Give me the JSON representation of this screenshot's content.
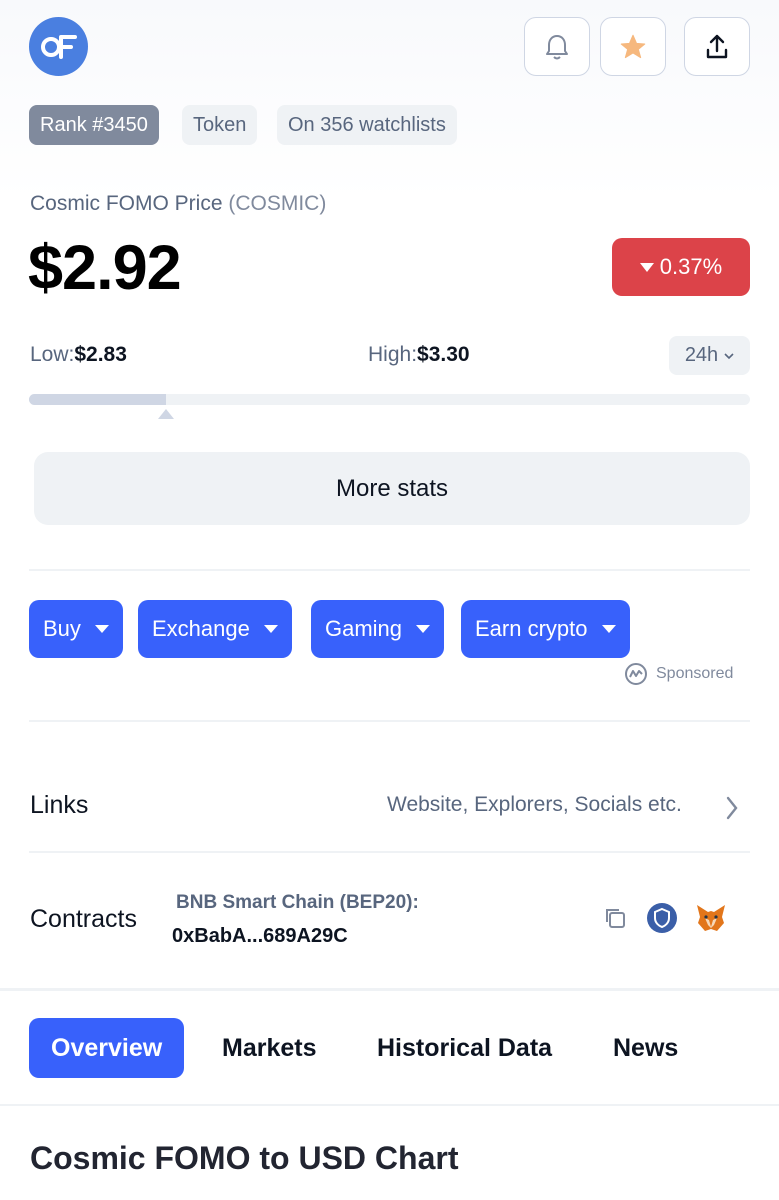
{
  "header": {
    "logo_icon": "cosmic-fomo-logo",
    "buttons": [
      {
        "icon": "bell-icon"
      },
      {
        "icon": "star-icon",
        "color": "#f6b87e"
      },
      {
        "icon": "share-icon"
      }
    ]
  },
  "badges": {
    "rank": "Rank #3450",
    "type": "Token",
    "watchlists": "On 356 watchlists"
  },
  "coin": {
    "name_label": "Cosmic FOMO Price",
    "symbol": "(COSMIC)",
    "price": "$2.92",
    "change": "0.37%",
    "change_direction": "down",
    "change_color": "#dc4349"
  },
  "range": {
    "low_label": "Low:",
    "low_value": "$2.83",
    "high_label": "High:",
    "high_value": "$3.30",
    "period": "24h",
    "position_fraction": 0.19
  },
  "more_stats_label": "More stats",
  "cta_buttons": [
    {
      "label": "Buy"
    },
    {
      "label": "Exchange"
    },
    {
      "label": "Gaming"
    },
    {
      "label": "Earn crypto"
    }
  ],
  "cta_color": "#3861fb",
  "sponsored_label": "Sponsored",
  "links": {
    "label": "Links",
    "summary": "Website, Explorers, Socials etc."
  },
  "contracts": {
    "label": "Contracts",
    "chain": "BNB Smart Chain (BEP20):",
    "address": "0xBabA...689A29C",
    "icons": [
      "copy-icon",
      "shield-icon",
      "metamask-fox-icon"
    ]
  },
  "tabs": [
    {
      "label": "Overview",
      "active": true
    },
    {
      "label": "Markets",
      "active": false
    },
    {
      "label": "Historical Data",
      "active": false
    },
    {
      "label": "News",
      "active": false
    }
  ],
  "section_title": "Cosmic FOMO to USD Chart"
}
